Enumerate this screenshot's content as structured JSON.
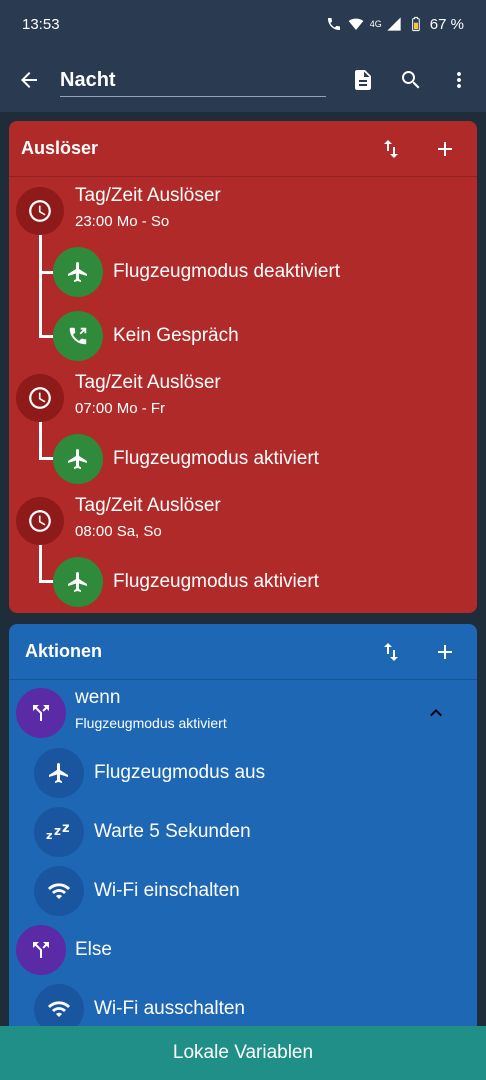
{
  "status": {
    "time": "13:53",
    "network": "4G",
    "battery": "67 %"
  },
  "appbar": {
    "macro_name": "Nacht"
  },
  "triggers": {
    "title": "Auslöser",
    "items": [
      {
        "title": "Tag/Zeit Auslöser",
        "detail": "23:00 Mo - So",
        "constraints": [
          "Flugzeugmodus deaktiviert",
          "Kein Gespräch"
        ]
      },
      {
        "title": "Tag/Zeit Auslöser",
        "detail": "07:00 Mo - Fr",
        "constraints": [
          "Flugzeugmodus aktiviert"
        ]
      },
      {
        "title": "Tag/Zeit Auslöser",
        "detail": "08:00 Sa, So",
        "constraints": [
          "Flugzeugmodus aktiviert"
        ]
      }
    ]
  },
  "actions": {
    "title": "Aktionen",
    "if_block": {
      "label": "wenn",
      "condition": "Flugzeugmodus aktiviert"
    },
    "if_actions": [
      "Flugzeugmodus aus",
      "Warte 5 Sekunden",
      "Wi-Fi einschalten"
    ],
    "else_label": "Else",
    "else_actions": [
      "Wi-Fi ausschalten"
    ]
  },
  "bottom_button": "Lokale Variablen",
  "colors": {
    "trigger_card": "#b02a2a",
    "action_card": "#1d67b5",
    "constraint_green": "#2f8a3c",
    "condition_purple": "#5b2aa6",
    "bottom_bar": "#1f8f88"
  }
}
